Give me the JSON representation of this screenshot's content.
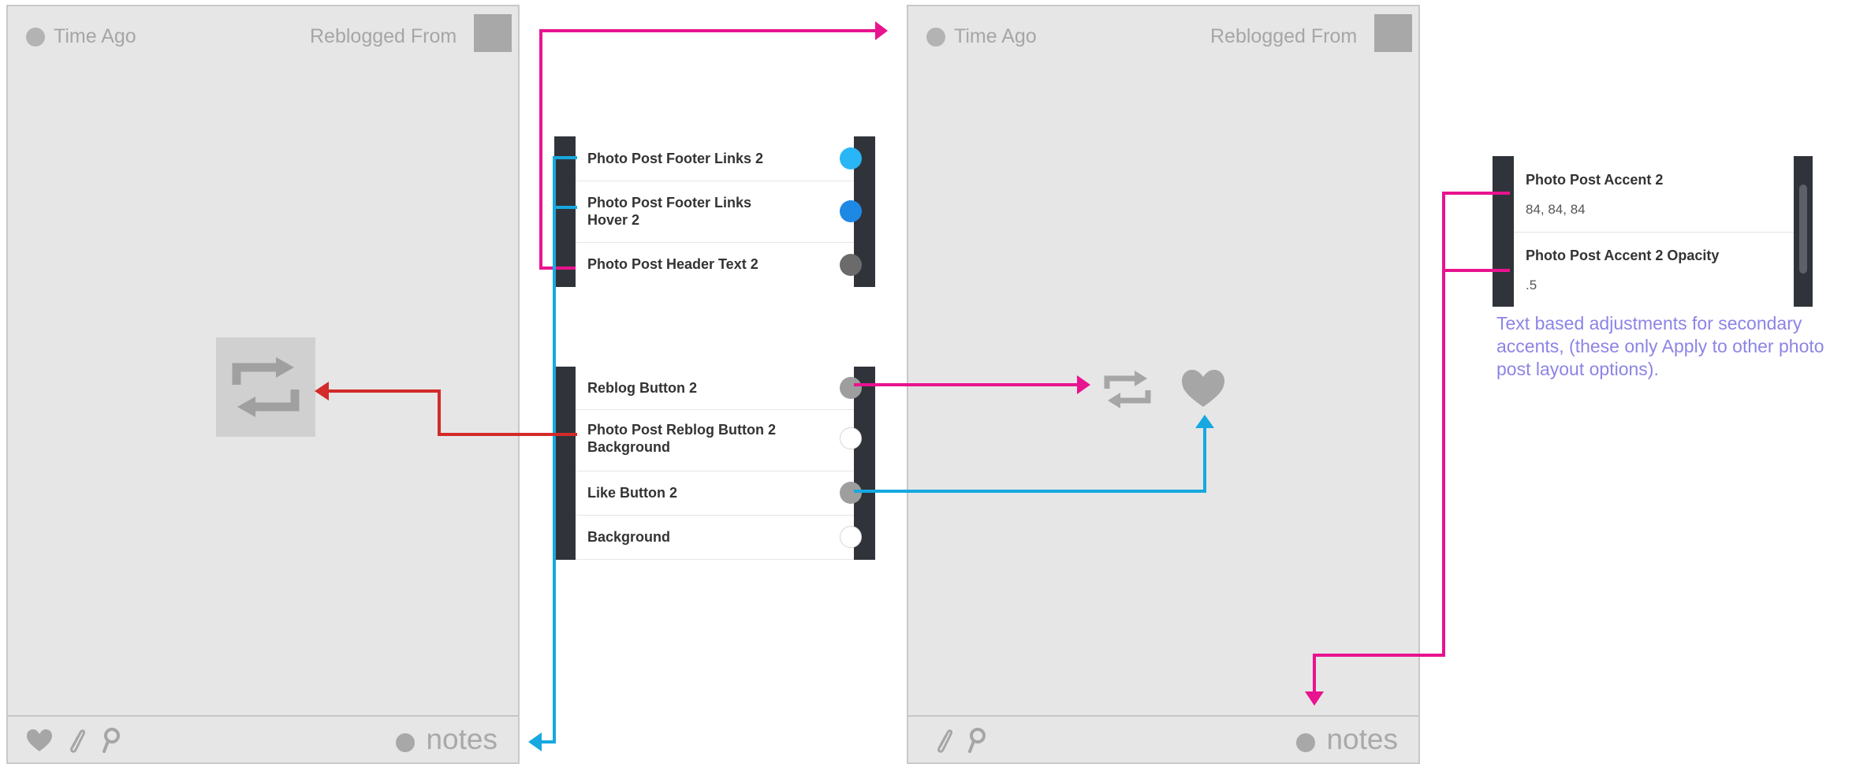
{
  "left_card": {
    "time_ago": "Time Ago",
    "reblogged_from": "Reblogged From",
    "notes": "notes",
    "footer_icons": [
      "heart-icon",
      "paperclip-icon",
      "search-icon"
    ],
    "center_icon": "reblog-icon"
  },
  "right_card": {
    "time_ago": "Time Ago",
    "reblogged_from": "Reblogged From",
    "notes": "notes",
    "footer_icons": [
      "paperclip-icon",
      "search-icon"
    ],
    "center_icons": [
      "reblog-icon",
      "heart-icon"
    ]
  },
  "panel_footer": {
    "rows": [
      {
        "label": "Photo Post Footer Links 2",
        "color": "#29b6f6"
      },
      {
        "label": "Photo Post Footer Links Hover 2",
        "color": "#1e88e5"
      },
      {
        "label": "Photo Post Header Text 2",
        "color": "#6b6b6b"
      }
    ]
  },
  "panel_buttons": {
    "rows": [
      {
        "label": "Reblog Button 2",
        "color": "#9e9e9e"
      },
      {
        "label": "Photo Post Reblog Button 2 Background",
        "color": "#ffffff"
      },
      {
        "label": "Like Button 2",
        "color": "#9e9e9e"
      },
      {
        "label": "Background",
        "color": "#ffffff"
      }
    ]
  },
  "panel_accent": {
    "rows": [
      {
        "label": "Photo Post Accent 2",
        "value": "84, 84, 84"
      },
      {
        "label": "Photo Post Accent 2 Opacity",
        "value": ".5"
      }
    ]
  },
  "note": "Text based adjustments for secondary accents, (these only Apply to other photo post layout options).",
  "colors": {
    "magenta_arrow": "#e8138f",
    "blue_arrow": "#16a8e0",
    "red_arrow": "#d32a2a",
    "note_text": "#8c84e6",
    "panel_bar": "#30343a",
    "card_bg": "#e6e6e6"
  }
}
